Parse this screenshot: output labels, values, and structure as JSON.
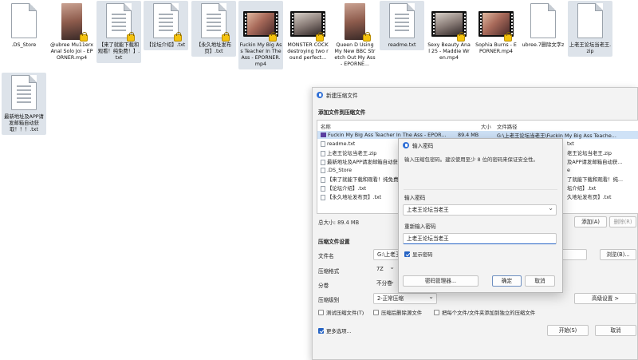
{
  "desktop": {
    "files": [
      {
        "name": ".DS_Store",
        "type": "doc"
      },
      {
        "name": "@ubree Mu11erx Anal Solo Joi - EPORNER.mp4",
        "type": "photo"
      },
      {
        "name": "【来了就能下载和观看！纯免费！】.txt",
        "type": "doc"
      },
      {
        "name": "【论坛介绍】.txt",
        "type": "doc"
      },
      {
        "name": "【永久地址发布页】.txt",
        "type": "doc"
      },
      {
        "name": "Fuckin My Big Ass Teacher In The Ass - EPORNER.mp4",
        "type": "video"
      },
      {
        "name": "MONSTER COCK destroying two round perfect...",
        "type": "video"
      },
      {
        "name": "Queen D Using My New BBC Stretch Out My Ass - EPORNE...",
        "type": "photo"
      },
      {
        "name": "readme.txt",
        "type": "doc"
      },
      {
        "name": "Sexy Beauty Anal 25 - Maddie Wren.mp4",
        "type": "video"
      },
      {
        "name": "Sophia Burns - EPORNER.mp4",
        "type": "video"
      },
      {
        "name": "ubree.7删除文字z",
        "type": "doc"
      },
      {
        "name": "上老王论坛当老王.zip",
        "type": "doc"
      },
      {
        "name": "最新地址及APP请发邮箱自动获取！！！.txt",
        "type": "doc"
      }
    ]
  },
  "archive_window": {
    "title": "新建压缩文件",
    "add_section_label": "添加文件到压缩文件",
    "columns": {
      "name": "名称",
      "size": "大小",
      "path": "文件路径"
    },
    "rows": [
      {
        "name": "Fuckin My Big Ass Teacher In The Ass - EPOR...",
        "size": "89.4 MB",
        "path": "G:\\上老王论坛当老王\\Fuckin My Big Ass Teache...",
        "icon": "video"
      },
      {
        "name": "readme.txt",
        "size": "",
        "path": "txt",
        "icon": "file"
      },
      {
        "name": "上老王论坛当老王.zip",
        "size": "",
        "path": "老王论坛当老王.zip",
        "icon": "file"
      },
      {
        "name": "最新地址及APP请发邮箱自动获",
        "size": "",
        "path": "及APP请发邮箱自动获...",
        "icon": "file"
      },
      {
        "name": ".DS_Store",
        "size": "",
        "path": "e",
        "icon": "file"
      },
      {
        "name": "【来了就能下载和观看！纯免费",
        "size": "",
        "path": "了就能下载和观看！纯...",
        "icon": "file"
      },
      {
        "name": "【论坛介绍】.txt",
        "size": "",
        "path": "坛介绍】.txt",
        "icon": "file"
      },
      {
        "name": "【永久地址发布页】.txt",
        "size": "",
        "path": "久地址发布页】.txt",
        "icon": "file"
      }
    ],
    "total_size": "总大小: 89.4 MB",
    "add_button": "添加(A)",
    "delete_button": "删除(R)",
    "settings_label": "压缩文件设置",
    "filename_label": "文件名",
    "filename_value": "G:\\上老王",
    "browse_button": "浏览(B)...",
    "format_label": "压缩格式",
    "format_value": "7Z",
    "split_label": "分卷",
    "split_value": "不分卷",
    "level_label": "压缩级别",
    "level_value": "2-正常压缩",
    "advanced_button": "高级设置 >",
    "test_checkbox": "测试压缩文件(T)",
    "delete_after_checkbox": "压缩后删除源文件",
    "separate_checkbox": "把每个文件/文件夹添加到独立的压缩文件",
    "more_options": "更多选项...",
    "start_button": "开始(S)",
    "cancel_button": "取消"
  },
  "password_dialog": {
    "title": "输入密码",
    "hint": "输入压缩包密码。建议使用至少 8 位的密码来保证安全性。",
    "password_label": "输入密码",
    "password_value": "上老王论坛当老王",
    "confirm_label": "重新输入密码",
    "confirm_value": "上老王论坛当老王",
    "show_password": "显示密码",
    "manager_button": "密码管理器...",
    "ok_button": "确定",
    "cancel_button": "取消"
  },
  "colors": {
    "accent": "#2563c4",
    "selection": "#cfe2f7",
    "lock": "#f4c20d"
  }
}
